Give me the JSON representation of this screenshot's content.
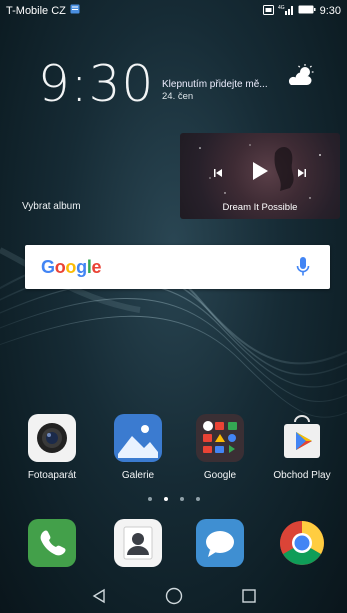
{
  "status_bar": {
    "carrier": "T-Mobile CZ",
    "time": "9:30",
    "icons": [
      "notification-icon",
      "nfc-icon",
      "signal-icon",
      "battery-icon"
    ]
  },
  "clock": {
    "time": "9:30"
  },
  "weather": {
    "text": "Klepnutím přidejte mě...",
    "date": "24. čen",
    "icon": "partly-cloudy-icon"
  },
  "music_widget": {
    "album_label": "Vybrat album",
    "song_title": "Dream It Possible",
    "controls": [
      "previous-icon",
      "play-icon",
      "next-icon"
    ]
  },
  "search": {
    "logo": "Google",
    "icon": "mic-icon",
    "colors": {
      "blue": "#4285F4",
      "red": "#EA4335",
      "yellow": "#FBBC05",
      "green": "#34A853"
    }
  },
  "apps": [
    {
      "label": "Fotoaparát",
      "icon": "camera-icon"
    },
    {
      "label": "Galerie",
      "icon": "gallery-icon"
    },
    {
      "label": "Google",
      "icon": "google-folder-icon"
    },
    {
      "label": "Obchod Play",
      "icon": "play-store-icon"
    }
  ],
  "pager": {
    "pages": 4,
    "active_index": 1
  },
  "dock": [
    {
      "icon": "phone-icon"
    },
    {
      "icon": "contacts-icon"
    },
    {
      "icon": "messages-icon"
    },
    {
      "icon": "chrome-icon"
    }
  ],
  "nav_bar": {
    "icons": [
      "back-icon",
      "home-icon",
      "recents-icon"
    ]
  }
}
